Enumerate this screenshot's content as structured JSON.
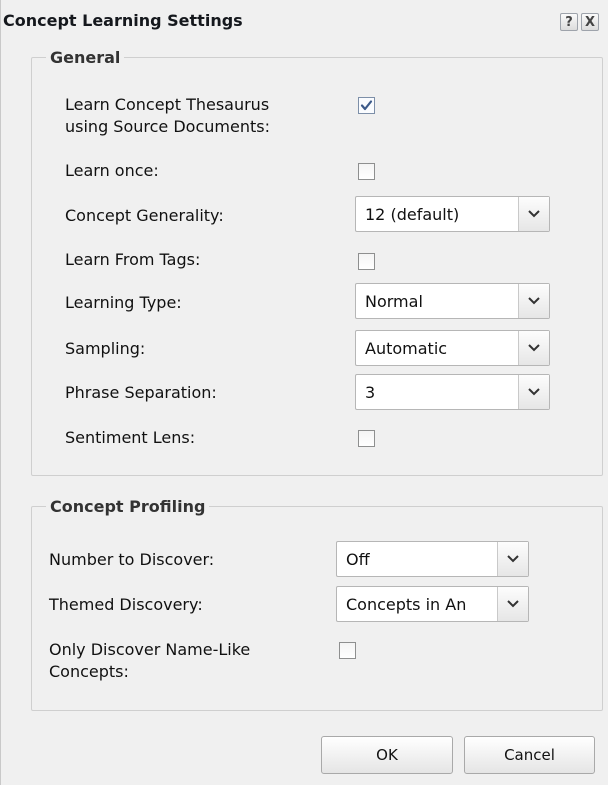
{
  "dialog": {
    "title": "Concept Learning Settings",
    "help_label": "?",
    "close_label": "X"
  },
  "general": {
    "legend": "General",
    "learn_thesaurus_label_line1": "Learn Concept Thesaurus",
    "learn_thesaurus_label_line2": "using Source Documents:",
    "learn_thesaurus_checked": true,
    "learn_once_label": "Learn once:",
    "learn_once_checked": false,
    "concept_generality_label": "Concept Generality:",
    "concept_generality_value": "12 (default)",
    "learn_from_tags_label": "Learn From Tags:",
    "learn_from_tags_checked": false,
    "learning_type_label": "Learning Type:",
    "learning_type_value": "Normal",
    "sampling_label": "Sampling:",
    "sampling_value": "Automatic",
    "phrase_separation_label": "Phrase Separation:",
    "phrase_separation_value": "3",
    "sentiment_lens_label": "Sentiment Lens:",
    "sentiment_lens_checked": false
  },
  "profiling": {
    "legend": "Concept Profiling",
    "number_to_discover_label": "Number to Discover:",
    "number_to_discover_value": "Off",
    "themed_discovery_label": "Themed Discovery:",
    "themed_discovery_value": "Concepts in An",
    "name_like_label_line1": "Only Discover Name-Like",
    "name_like_label_line2": "Concepts:",
    "name_like_checked": false
  },
  "footer": {
    "ok_label": "OK",
    "cancel_label": "Cancel"
  },
  "icons": {
    "checkmark": "checkmark-icon",
    "dropdown": "chevron-down-icon"
  },
  "colors": {
    "background": "#f0f0f0",
    "checkmark": "#3c5a8a",
    "border": "#cfcfcf"
  }
}
